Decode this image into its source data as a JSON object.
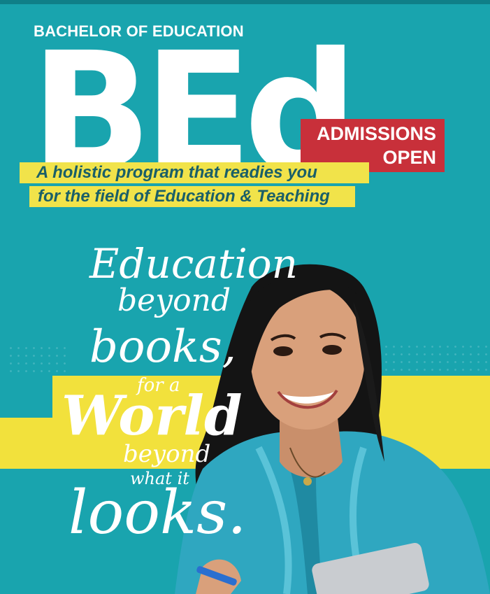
{
  "poster": {
    "kicker": "BACHELOR OF EDUCATION",
    "title": "BEd",
    "badge_line1": "ADMISSIONS",
    "badge_line2": "OPEN",
    "tagline_line1": "A holistic program that readies you",
    "tagline_line2": "for the field of Education & Teaching"
  },
  "slogan": {
    "line1": "Education",
    "line2": "beyond",
    "line3": "books,",
    "line4": "for a",
    "line5": "World",
    "line6": "beyond",
    "line7": "what it",
    "line8": "looks."
  },
  "colors": {
    "background": "#19a4ae",
    "stripe": "#f2e13c",
    "badge": "#c8303a",
    "tagline_text": "#1a5f68"
  },
  "image": {
    "subject": "smiling woman in teal hoodie holding laptop"
  }
}
